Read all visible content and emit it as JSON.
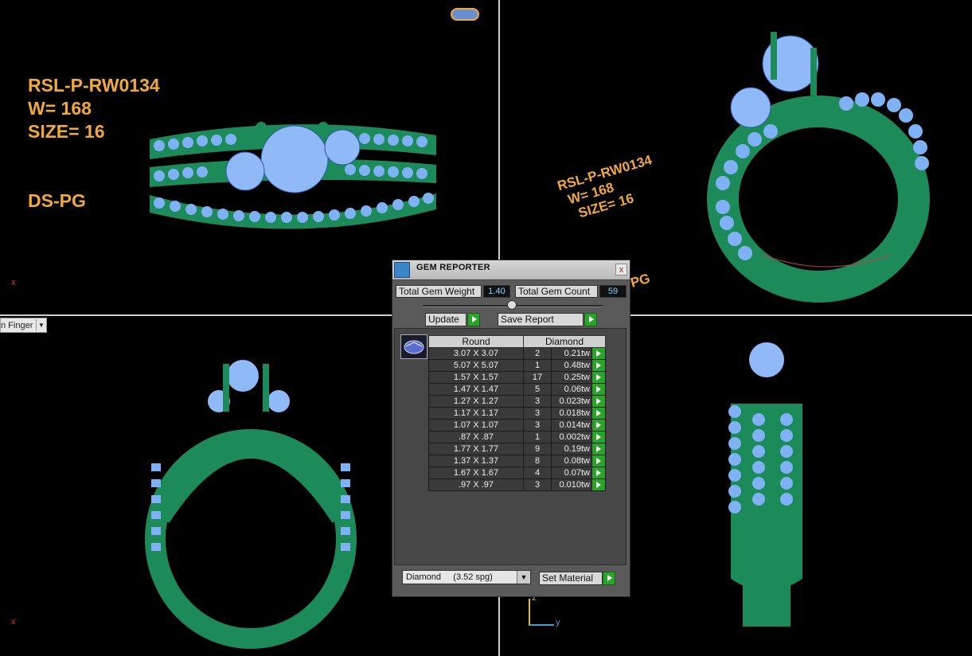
{
  "viewport_front": {
    "part": "RSL-P-RW0134",
    "weight": "W= 168",
    "size": "SIZE= 16",
    "code": "DS-PG"
  },
  "viewport_perspective": {
    "part": "RSL-P-RW0134",
    "weight": "W= 168",
    "size": "SIZE= 16",
    "code_partial": "PG"
  },
  "viewport_left": {
    "combo_value": "n Finger"
  },
  "axes": {
    "x": "x",
    "z": "z",
    "y": "y"
  },
  "gem_reporter": {
    "title": "GEM REPORTER",
    "close": "x",
    "total_weight_label": "Total Gem Weight",
    "total_weight_value": "1.40",
    "total_count_label": "Total Gem Count",
    "total_count_value": "59",
    "update_label": "Update",
    "save_label": "Save Report",
    "col_shape": "Round",
    "col_material": "Diamond",
    "rows": [
      {
        "size": "3.07 X 3.07",
        "count": "2",
        "tw": "0.21tw"
      },
      {
        "size": "5.07 X 5.07",
        "count": "1",
        "tw": "0.48tw"
      },
      {
        "size": "1.57 X 1.57",
        "count": "17",
        "tw": "0.25tw"
      },
      {
        "size": "1.47 X 1.47",
        "count": "5",
        "tw": "0.06tw"
      },
      {
        "size": "1.27 X 1.27",
        "count": "3",
        "tw": "0.023tw"
      },
      {
        "size": "1.17 X 1.17",
        "count": "3",
        "tw": "0.018tw"
      },
      {
        "size": "1.07 X 1.07",
        "count": "3",
        "tw": "0.014tw"
      },
      {
        "size": ".87 X .87",
        "count": "1",
        "tw": "0.002tw"
      },
      {
        "size": "1.77 X 1.77",
        "count": "9",
        "tw": "0.19tw"
      },
      {
        "size": "1.37 X 1.37",
        "count": "8",
        "tw": "0.08tw"
      },
      {
        "size": "1.67 X 1.67",
        "count": "4",
        "tw": "0.07tw"
      },
      {
        "size": ".97 X .97",
        "count": "3",
        "tw": "0.010tw"
      }
    ],
    "material_select": "Diamond     (3.52 spg)",
    "set_material_label": "Set Material"
  },
  "colors": {
    "metal": "#1d8a5a",
    "gem": "#7fb2f5",
    "text": "#f2a93b",
    "accent_green": "#2aa52a"
  }
}
